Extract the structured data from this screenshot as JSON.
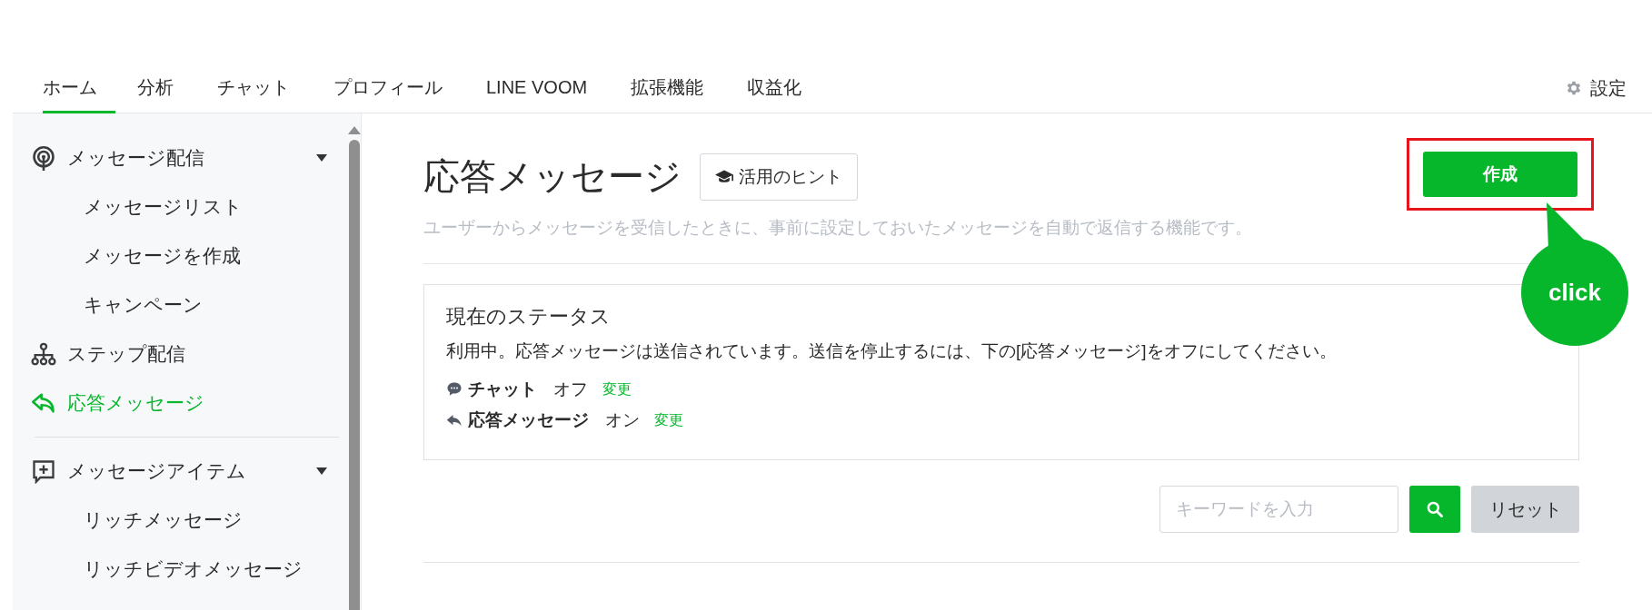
{
  "nav": {
    "tabs": [
      {
        "label": "ホーム",
        "selected": true
      },
      {
        "label": "分析",
        "selected": false
      },
      {
        "label": "チャット",
        "selected": false
      },
      {
        "label": "プロフィール",
        "selected": false
      },
      {
        "label": "LINE VOOM",
        "selected": false
      },
      {
        "label": "拡張機能",
        "selected": false
      },
      {
        "label": "収益化",
        "selected": false
      }
    ],
    "settings": "設定"
  },
  "sidebar": {
    "sections": [
      {
        "items": [
          {
            "label": "メッセージ配信",
            "selected": false,
            "expanded": true,
            "children": [
              {
                "label": "メッセージリスト",
                "selected": false
              },
              {
                "label": "メッセージを作成",
                "selected": false
              },
              {
                "label": "キャンペーン",
                "selected": false
              }
            ]
          },
          {
            "label": "ステップ配信",
            "selected": false
          },
          {
            "label": "応答メッセージ",
            "selected": true
          }
        ]
      },
      {
        "items": [
          {
            "label": "メッセージアイテム",
            "selected": false,
            "expanded": true,
            "children": [
              {
                "label": "リッチメッセージ",
                "selected": false
              },
              {
                "label": "リッチビデオメッセージ",
                "selected": false
              }
            ]
          }
        ]
      }
    ]
  },
  "main": {
    "title": "応答メッセージ",
    "hint_button": "活用のヒント",
    "create_button": "作成",
    "description": "ユーザーからメッセージを受信したときに、事前に設定しておいたメッセージを自動で返信する機能です。",
    "callout": "click",
    "status": {
      "title": "現在のステータス",
      "text": "利用中。応答メッセージは送信されています。送信を停止するには、下の[応答メッセージ]をオフにしてください。",
      "rows": [
        {
          "label": "チャット",
          "value": "オフ",
          "link": "変更"
        },
        {
          "label": "応答メッセージ",
          "value": "オン",
          "link": "変更"
        }
      ]
    },
    "search": {
      "placeholder": "キーワードを入力"
    },
    "reset_button": "リセット"
  }
}
